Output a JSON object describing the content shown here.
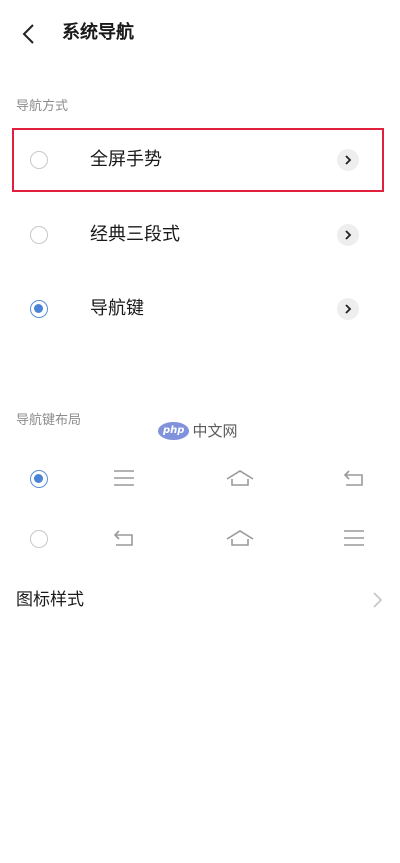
{
  "header": {
    "title": "系统导航"
  },
  "nav_mode": {
    "section_title": "导航方式",
    "options": [
      {
        "label": "全屏手势",
        "selected": false
      },
      {
        "label": "经典三段式",
        "selected": false
      },
      {
        "label": "导航键",
        "selected": true
      }
    ]
  },
  "nav_layout": {
    "section_title": "导航键布局",
    "options": [
      {
        "selected": true,
        "icons": [
          "menu-icon",
          "home-icon",
          "back-icon"
        ]
      },
      {
        "selected": false,
        "icons": [
          "back-icon",
          "home-icon",
          "menu-icon"
        ]
      }
    ]
  },
  "watermark": {
    "badge": "php",
    "text": "中文网"
  },
  "icon_style": {
    "label": "图标样式"
  },
  "colors": {
    "accent": "#4a84d6",
    "highlight_border": "#e0203c",
    "muted_text": "#8c8c8c"
  }
}
